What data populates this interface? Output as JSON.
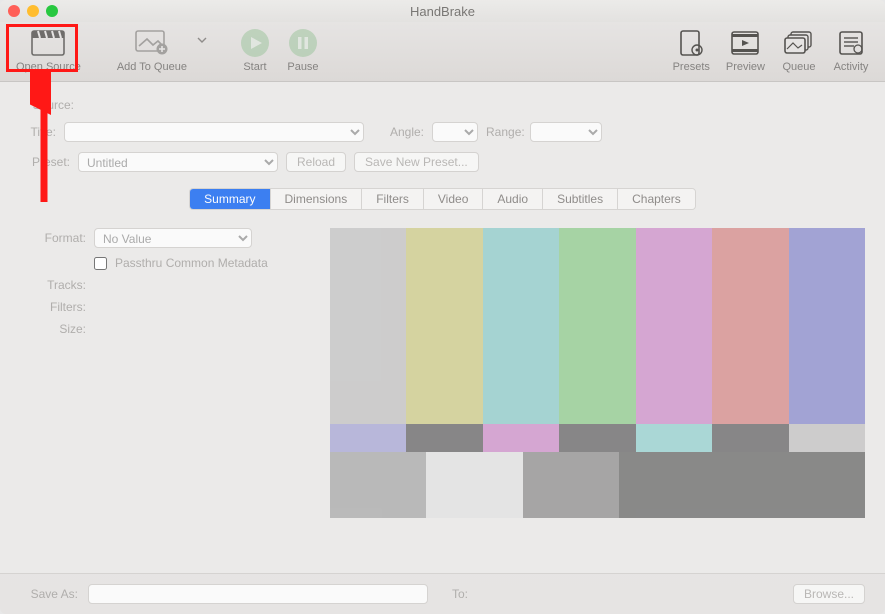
{
  "app": {
    "title": "HandBrake"
  },
  "toolbar": {
    "openSource": "Open Source",
    "addToQueue": "Add To Queue",
    "start": "Start",
    "pause": "Pause",
    "presets": "Presets",
    "preview": "Preview",
    "queue": "Queue",
    "activity": "Activity"
  },
  "labels": {
    "source": "Source:",
    "title": "Title:",
    "angle": "Angle:",
    "range": "Range:",
    "preset": "Preset:",
    "reload": "Reload",
    "saveNewPreset": "Save New Preset...",
    "format": "Format:",
    "tracks": "Tracks:",
    "filters": "Filters:",
    "size": "Size:",
    "passthru": "Passthru Common Metadata",
    "saveAs": "Save As:",
    "to": "To:",
    "browse": "Browse..."
  },
  "tabs": [
    "Summary",
    "Dimensions",
    "Filters",
    "Video",
    "Audio",
    "Subtitles",
    "Chapters"
  ],
  "presetSelected": "Untitled",
  "formatSelected": "No Value",
  "colors": {
    "barsTop": [
      "#bbbbbb",
      "#c8c674",
      "#7bc6c5",
      "#7cc67a",
      "#c87dc5",
      "#d27776",
      "#7779c8"
    ],
    "barsMid": [
      "#9a99d2",
      "#4b4a4c",
      "#c87dc5",
      "#4b4a4c",
      "#83cccb",
      "#4b4a4c",
      "#bbbbbb"
    ],
    "barsBot": [
      "#9c9c9c",
      "#e1e1e1",
      "#7c7c7c",
      "#4e4e4e"
    ]
  }
}
